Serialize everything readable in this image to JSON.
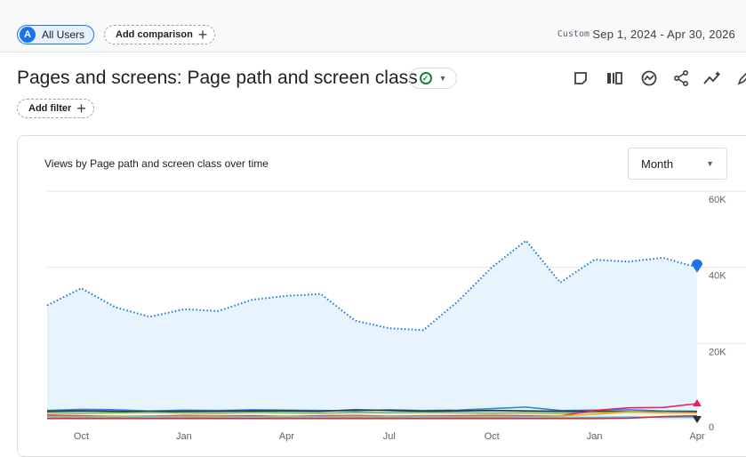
{
  "segments": {
    "all_users": {
      "avatar_letter": "A",
      "label": "All Users"
    },
    "add_comparison_label": "Add comparison"
  },
  "date": {
    "mode": "Custom",
    "range": "Sep 1, 2024 - Apr 30, 2026"
  },
  "report": {
    "title": "Pages and screens: Page path and screen class",
    "add_filter_label": "Add filter"
  },
  "toolbar_icons": [
    "edit-comparison-icon",
    "customize-report-icon",
    "insights-icon",
    "share-icon",
    "trending-icon",
    "pencil-icon"
  ],
  "chart_card": {
    "title": "Views by Page path and screen class over time",
    "granularity": "Month"
  },
  "colors": {
    "total": "#1a73e8",
    "fill": "#e8f4fd",
    "series_blue": "#1e88e5",
    "series_dark": "#263238",
    "series_green": "#7cb342",
    "series_pink": "#e91e63",
    "series_red": "#d32f2f",
    "series_yellow": "#f9ab00",
    "series_lightblue": "#4fc3f7"
  },
  "chart_data": {
    "type": "area",
    "x": [
      "Sep 2024",
      "Oct 2024",
      "Nov 2024",
      "Dec 2024",
      "Jan 2025",
      "Feb 2025",
      "Mar 2025",
      "Apr 2025",
      "May 2025",
      "Jun 2025",
      "Jul 2025",
      "Aug 2025",
      "Sep 2025",
      "Oct 2025",
      "Nov 2025",
      "Dec 2025",
      "Jan 2026",
      "Feb 2026",
      "Mar 2026",
      "Apr 2026"
    ],
    "xtick_labels": [
      {
        "at": "Oct 2024",
        "label": "Oct"
      },
      {
        "at": "Jan 2025",
        "label": "Jan"
      },
      {
        "at": "Apr 2025",
        "label": "Apr"
      },
      {
        "at": "Jul 2025",
        "label": "Jul"
      },
      {
        "at": "Oct 2025",
        "label": "Oct"
      },
      {
        "at": "Jan 2026",
        "label": "Jan"
      },
      {
        "at": "Apr 2026",
        "label": "Apr"
      }
    ],
    "ytick_labels": [
      "0",
      "20K",
      "40K",
      "60K"
    ],
    "ylim": [
      0,
      60000
    ],
    "grid": true,
    "series": [
      {
        "values": [
          30000,
          34500,
          29500,
          27000,
          29000,
          28500,
          31500,
          32500,
          33000,
          26000,
          24000,
          23500,
          31000,
          40000,
          47000,
          36000,
          42000,
          41500,
          42500,
          40000
        ]
      },
      {
        "values": [
          2400,
          2700,
          2600,
          2300,
          2500,
          2400,
          2600,
          2500,
          2400,
          2300,
          2600,
          2400,
          2500,
          2900,
          3300,
          2400,
          2500,
          2600,
          2300,
          2200
        ]
      },
      {
        "values": [
          2200,
          2300,
          2200,
          2100,
          2200,
          2200,
          2300,
          2300,
          2200,
          2600,
          2400,
          2200,
          2300,
          2400,
          2300,
          2200,
          2200,
          2100,
          2000,
          2100
        ]
      },
      {
        "values": [
          1800,
          1700,
          1800,
          1900,
          1800,
          1700,
          1900,
          1800,
          1700,
          1900,
          1800,
          1900,
          1800,
          1700,
          1800,
          1700,
          1900,
          2000,
          1900,
          1800
        ]
      },
      {
        "values": [
          1200,
          1000,
          900,
          900,
          1100,
          1000,
          1000,
          900,
          1000,
          1100,
          900,
          1000,
          1000,
          1100,
          1000,
          1000,
          2400,
          3100,
          3200,
          4200
        ]
      },
      {
        "values": [
          900,
          800,
          900,
          800,
          900,
          900,
          800,
          900,
          800,
          900,
          800,
          900,
          800,
          900,
          800,
          1000,
          1400,
          2000,
          1800,
          1800
        ]
      },
      {
        "values": [
          700,
          600,
          600,
          700,
          600,
          600,
          700,
          600,
          700,
          600,
          600,
          700,
          600,
          600,
          700,
          600,
          600,
          700,
          600,
          600
        ]
      },
      {
        "values": [
          300,
          300,
          300,
          300,
          300,
          300,
          300,
          300,
          300,
          300,
          300,
          300,
          300,
          300,
          300,
          300,
          300,
          400,
          800,
          1000
        ]
      }
    ]
  }
}
